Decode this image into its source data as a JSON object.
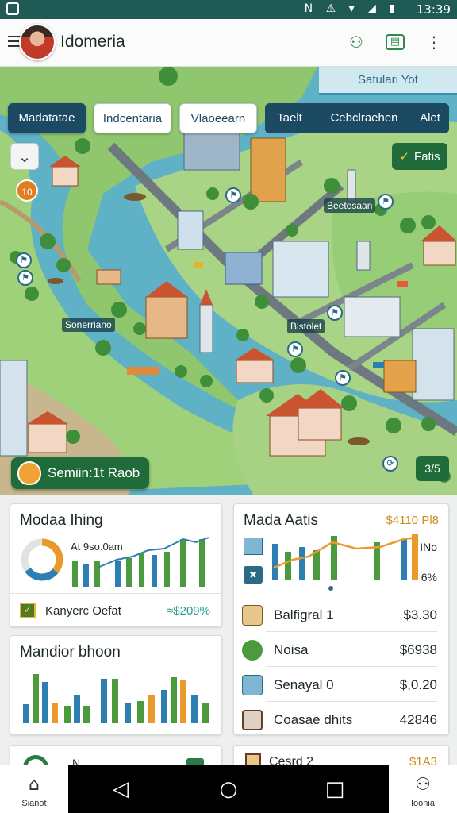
{
  "status_bar": {
    "icons": "N ⚠ ▾ ◢ ▮",
    "time": "13:39"
  },
  "app_bar": {
    "title": "Idomeria"
  },
  "map": {
    "banner": "Satulari Yot",
    "tabs": [
      "Madatatae",
      "Indcentaria",
      "Vlaoeearn",
      "Taelt",
      "Cebclraehen",
      "Alet"
    ],
    "filter_label": "Fatis",
    "orange_badge": "10",
    "labels": {
      "north": "Beetesaan",
      "west": "Sonerriano",
      "center": "Blstolet"
    },
    "route_button": "Semiin:1t Raob",
    "corner_button": "3/5"
  },
  "card_left_top": {
    "title": "Modaa Ihing",
    "donut_label": "At 9so.0am",
    "footer_label": "Kanyerc Oefat",
    "footer_value": "≈$209%",
    "colors": {
      "green": "#4c9a3e",
      "blue": "#2e7fb1",
      "orange": "#e89b2a"
    }
  },
  "card_left_bottom": {
    "title": "Mandior bhoon"
  },
  "card_right": {
    "title": "Mada Aatis",
    "amount": "$4110 Pl8",
    "side_top": "INo",
    "side_bottom": "6%",
    "rows": [
      {
        "label": "Balfigral 1",
        "value": "$3.30"
      },
      {
        "label": "Noisa",
        "value": "$6938"
      },
      {
        "label": "Senayal 0",
        "value": "$,0.20"
      },
      {
        "label": "Coasae dhits",
        "value": "42846"
      },
      {
        "label": "Cesrd 2",
        "value": "$1A3"
      }
    ]
  },
  "partial_card": {
    "label": "N"
  },
  "bottom_nav": {
    "left": "Sianot",
    "right": "Ioonia"
  }
}
